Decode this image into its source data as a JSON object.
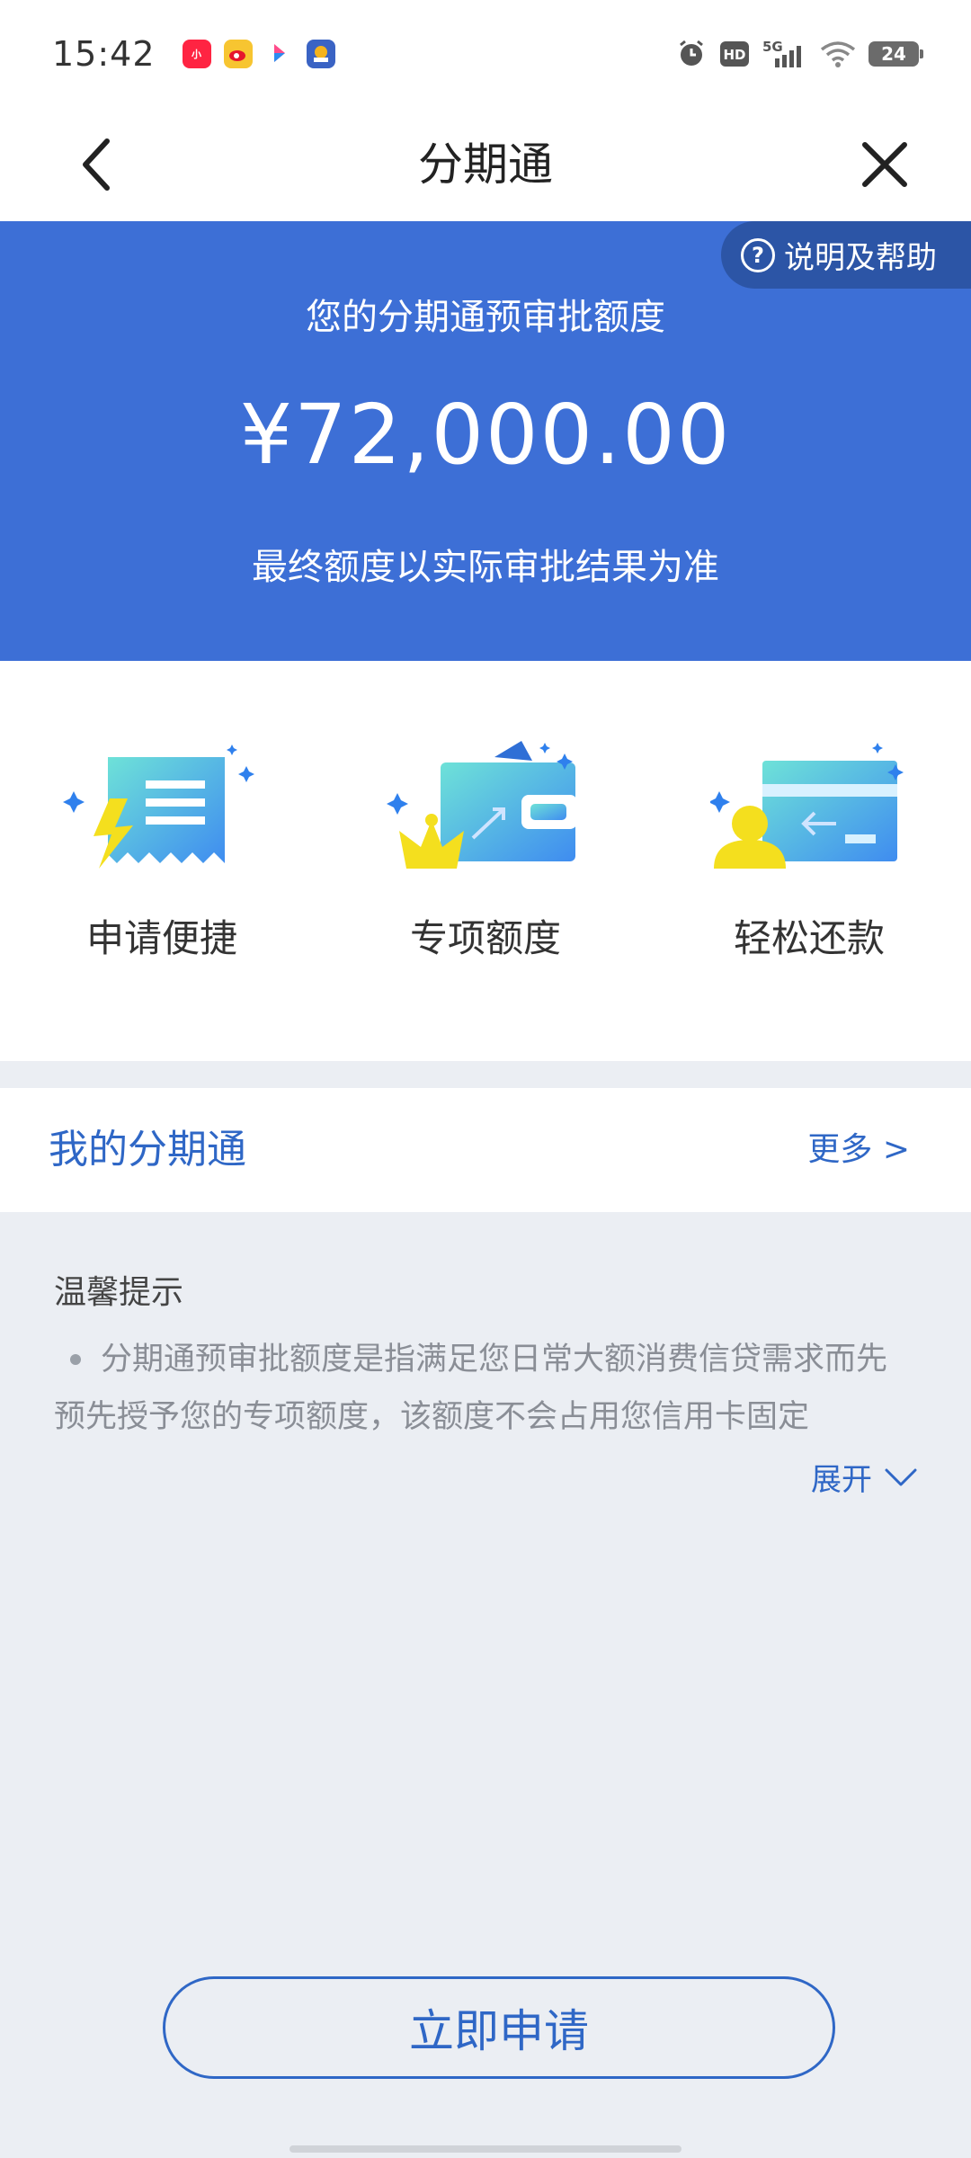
{
  "status_bar": {
    "time": "15:42",
    "battery": "24",
    "network": "5G",
    "hd": "HD",
    "apps": [
      "xiaohongshu-icon",
      "weibo-icon",
      "bilibili-icon",
      "game-icon"
    ]
  },
  "header": {
    "title": "分期通"
  },
  "banner": {
    "help_label": "说明及帮助",
    "subtitle": "您的分期通预审批额度",
    "amount": "¥72,000.00",
    "note": "最终额度以实际审批结果为准",
    "background_color": "#3d6fd6"
  },
  "features": [
    {
      "label": "申请便捷",
      "icon": "receipt-lightning-icon"
    },
    {
      "label": "专项额度",
      "icon": "wallet-crown-icon"
    },
    {
      "label": "轻松还款",
      "icon": "card-person-icon"
    }
  ],
  "my_section": {
    "title": "我的分期通",
    "more": "更多 >"
  },
  "tips": {
    "title": "温馨提示",
    "text": "分期通预审批额度是指满足您日常大额消费信贷需求而先预先授予您的专项额度，该额度不会占用您信用卡固定",
    "expand": "展开"
  },
  "apply_button": {
    "label": "立即申请"
  },
  "colors": {
    "accent": "#2f67c6"
  }
}
